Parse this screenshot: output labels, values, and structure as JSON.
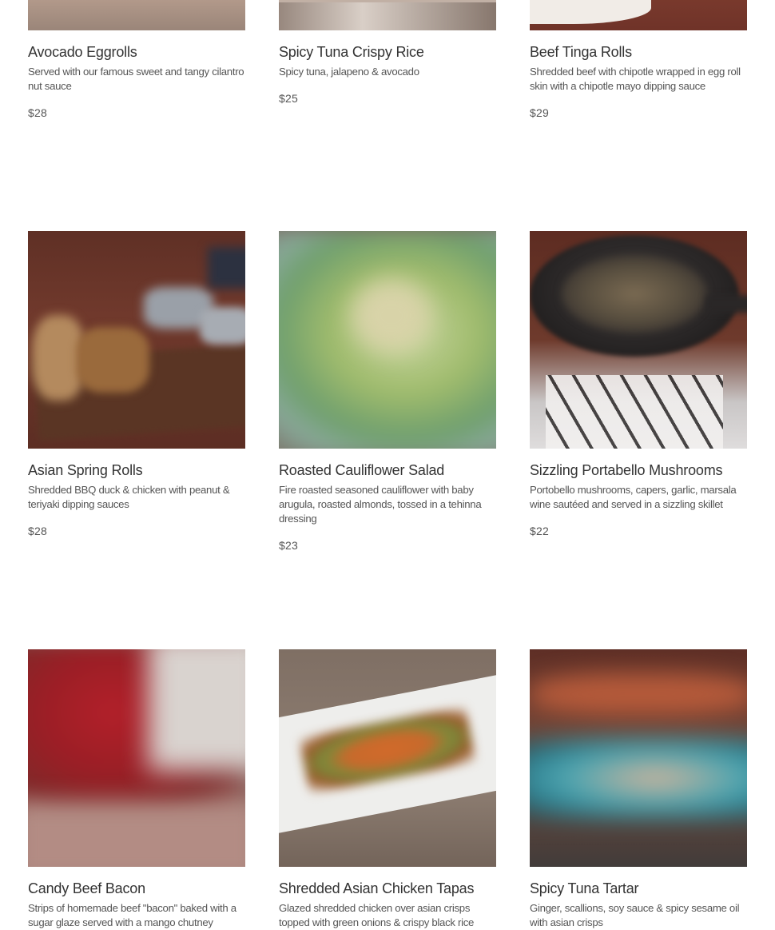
{
  "menu": {
    "items": [
      {
        "name": "Avocado Eggrolls",
        "description": "Served with our famous sweet and tangy cilantro nut sauce",
        "price": "$28"
      },
      {
        "name": "Spicy Tuna Crispy Rice",
        "description": "Spicy tuna, jalapeno & avocado",
        "price": "$25"
      },
      {
        "name": "Beef Tinga Rolls",
        "description": "Shredded beef with chipotle wrapped in egg roll skin with a chipotle mayo dipping sauce",
        "price": "$29"
      },
      {
        "name": "Asian Spring Rolls",
        "description": "Shredded BBQ duck & chicken with peanut & teriyaki dipping sauces",
        "price": "$28"
      },
      {
        "name": "Roasted Cauliflower Salad",
        "description": "Fire roasted seasoned cauliflower with baby arugula, roasted almonds, tossed in a tehinna dressing",
        "price": "$23"
      },
      {
        "name": "Sizzling Portabello Mushrooms",
        "description": "Portobello mushrooms, capers, garlic, marsala wine sautéed and served in a sizzling skillet",
        "price": "$22"
      },
      {
        "name": "Candy Beef Bacon",
        "description": "Strips of homemade beef \"bacon\" baked with a sugar glaze served with a mango chutney",
        "price": ""
      },
      {
        "name": "Shredded Asian Chicken Tapas",
        "description": "Glazed shredded chicken over asian crisps topped with green onions & crispy black rice",
        "price": ""
      },
      {
        "name": "Spicy Tuna Tartar",
        "description": "Ginger, scallions, soy sauce & spicy sesame oil with asian crisps",
        "price": ""
      }
    ]
  }
}
